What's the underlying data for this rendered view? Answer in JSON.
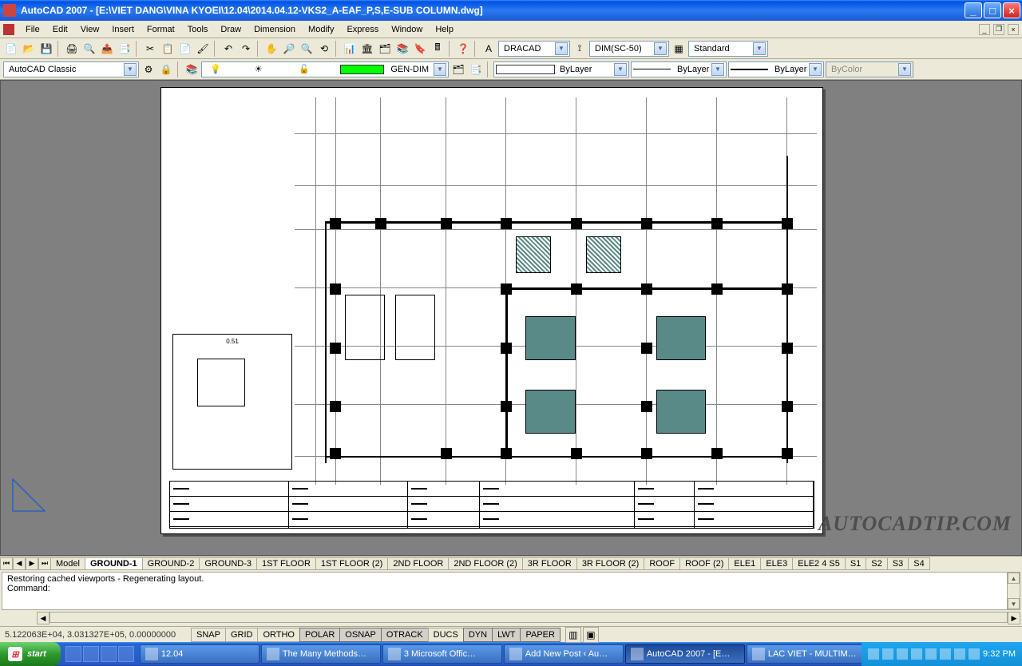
{
  "window": {
    "title": "AutoCAD 2007 - [E:\\VIET DANG\\VINA KYOEI\\12.04\\2014.04.12-VKS2_A-EAF_P,S,E-SUB COLUMN.dwg]"
  },
  "menu": [
    "File",
    "Edit",
    "View",
    "Insert",
    "Format",
    "Tools",
    "Draw",
    "Dimension",
    "Modify",
    "Express",
    "Window",
    "Help"
  ],
  "workspace": {
    "value": "AutoCAD Classic"
  },
  "layer_combo": {
    "value": "GEN-DIM"
  },
  "props": {
    "color_value": "ByLayer",
    "linetype_value": "ByLayer",
    "lineweight_value": "ByLayer",
    "plotstyle_value": "ByColor"
  },
  "textstyle": {
    "value": "DRACAD"
  },
  "dimstyle": {
    "value": "DIM(SC-50)"
  },
  "tablestyle": {
    "value": "Standard"
  },
  "legend": {
    "label": "0.51"
  },
  "tabs": [
    "Model",
    "GROUND-1",
    "GROUND-2",
    "GROUND-3",
    "1ST FLOOR",
    "1ST FLOOR (2)",
    "2ND FLOOR",
    "2ND FLOOR (2)",
    "3R FLOOR",
    "3R FLOOR (2)",
    "ROOF",
    "ROOF (2)",
    "ELE1",
    "ELE3",
    "ELE2 4 S5",
    "S1",
    "S2",
    "S3",
    "S4"
  ],
  "command": {
    "line1": "Restoring cached viewports - Regenerating layout.",
    "line2": "Command:"
  },
  "status": {
    "coords": "5.122063E+04, 3.031327E+05, 0.00000000",
    "toggles": [
      "SNAP",
      "GRID",
      "ORTHO",
      "POLAR",
      "OSNAP",
      "OTRACK",
      "DUCS",
      "DYN",
      "LWT",
      "PAPER"
    ]
  },
  "watermark": "AUTOCADTIP.COM",
  "taskbar": {
    "start": "start",
    "tasks": [
      {
        "label": "12.04"
      },
      {
        "label": "The Many Methods…"
      },
      {
        "label": "3 Microsoft Offic…"
      },
      {
        "label": "Add New Post ‹ Au…"
      },
      {
        "label": "AutoCAD 2007 - [E…",
        "active": true
      },
      {
        "label": "LAC VIET - MULTIM…"
      }
    ],
    "clock": "9:32 PM"
  }
}
